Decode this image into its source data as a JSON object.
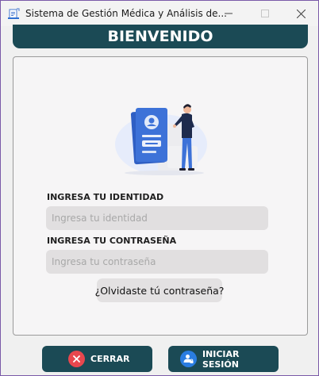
{
  "window": {
    "title": "Sistema de Gestión Médica y Análisis de...",
    "controls": [
      "minimize",
      "maximize",
      "close"
    ]
  },
  "header": {
    "title": "BIENVENIDO"
  },
  "form": {
    "identity_label": "INGRESA TU IDENTIDAD",
    "identity_placeholder": "Ingresa tu identidad",
    "identity_value": "",
    "password_label": "INGRESA TU CONTRASEÑA",
    "password_placeholder": "Ingresa tu contraseña",
    "password_value": "",
    "forgot_label": "¿Olvidaste tú contraseña?"
  },
  "actions": {
    "close_label": "CERRAR",
    "login_label": "INICIAR SESIÓN"
  },
  "colors": {
    "primary": "#1b4a55",
    "close_icon": "#e8474e",
    "login_icon": "#2a7de1",
    "illustration_accent": "#3d72d8"
  },
  "icons": {
    "app": "medical-app-icon",
    "close_button": "x-circle-icon",
    "login_button": "user-lock-icon",
    "illustration": "id-card-person-illustration"
  }
}
